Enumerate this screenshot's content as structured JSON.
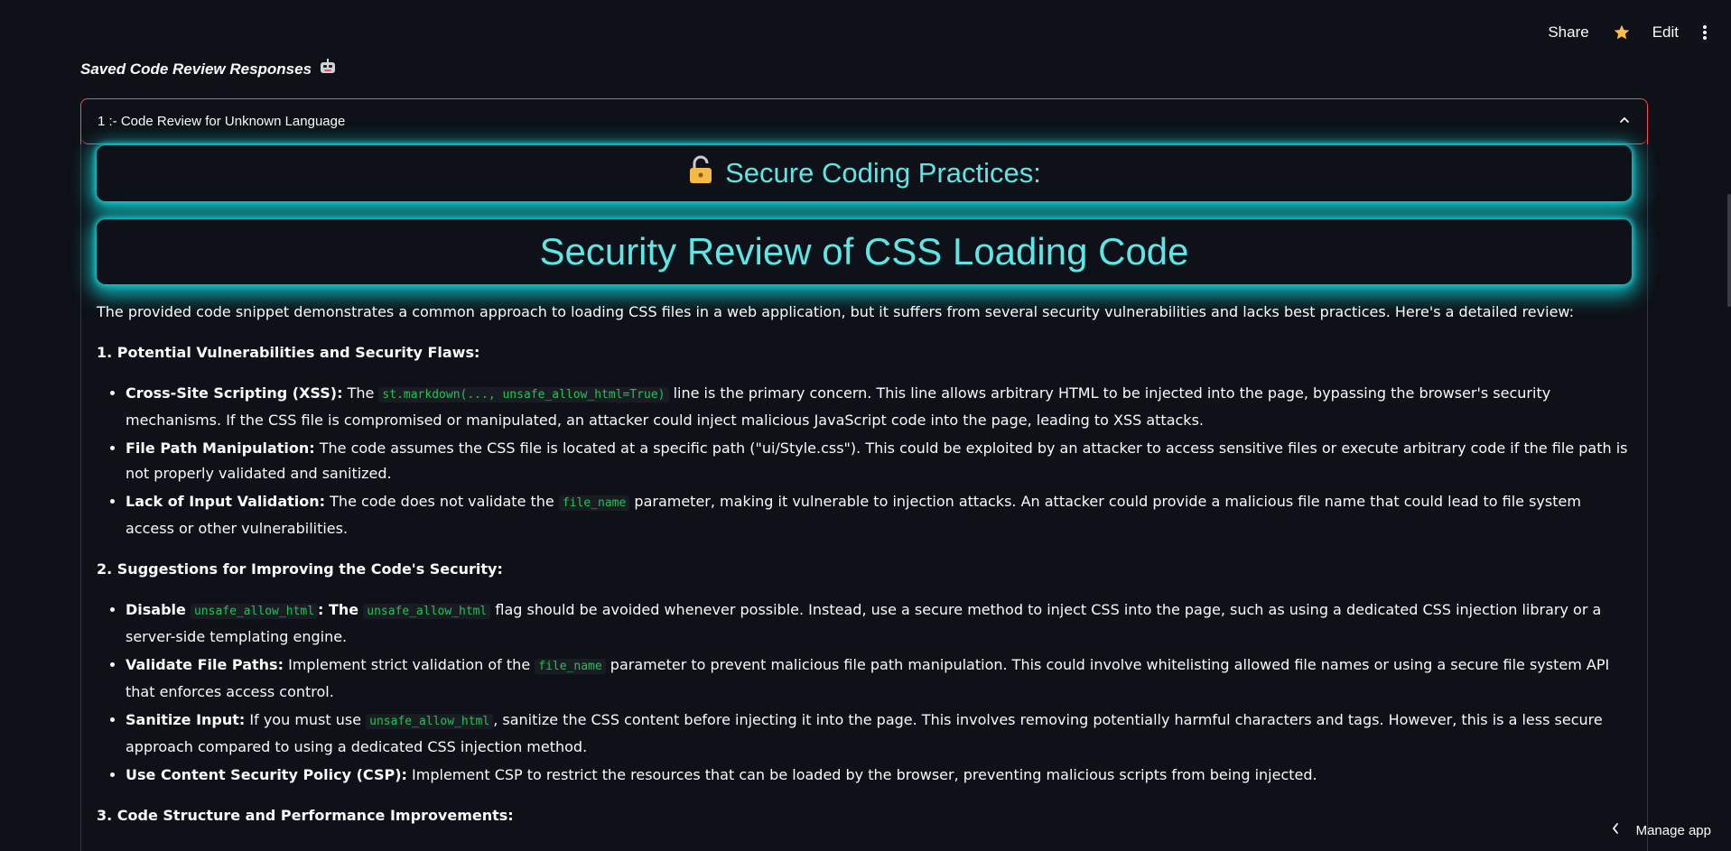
{
  "toolbar": {
    "share_label": "Share",
    "edit_label": "Edit"
  },
  "page": {
    "subtitle": "Saved Code Review Responses"
  },
  "expander": {
    "title": "1 :- Code Review for Unknown Language"
  },
  "headers": {
    "practices": "Secure Coding Practices:",
    "review_title": "Security Review of CSS Loading Code"
  },
  "content": {
    "intro": "The provided code snippet demonstrates a common approach to loading CSS files in a web application, but it suffers from several security vulnerabilities and lacks best practices. Here's a detailed review:",
    "section1": "1. Potential Vulnerabilities and Security Flaws:",
    "s1_items": [
      {
        "title": "Cross-Site Scripting (XSS):",
        "pre": "The",
        "code": "st.markdown(..., unsafe_allow_html=True)",
        "text": "line is the primary concern. This line allows arbitrary HTML to be injected into the page, bypassing the browser's security mechanisms. If the CSS file is compromised or manipulated, an attacker could inject malicious JavaScript code into the page, leading to XSS attacks."
      },
      {
        "title": "File Path Manipulation:",
        "text": "The code assumes the CSS file is located at a specific path (\"ui/Style.css\"). This could be exploited by an attacker to access sensitive files or execute arbitrary code if the file path is not properly validated and sanitized."
      },
      {
        "title": "Lack of Input Validation:",
        "pre": "The code does not validate the",
        "code": "file_name",
        "text": "parameter, making it vulnerable to injection attacks. An attacker could provide a malicious file name that could lead to file system access or other vulnerabilities."
      }
    ],
    "section2": "2. Suggestions for Improving the Code's Security:",
    "s2_items": [
      {
        "title": "Disable",
        "title_code": "unsafe_allow_html",
        "pre": ": The",
        "code": "unsafe_allow_html",
        "text": "flag should be avoided whenever possible. Instead, use a secure method to inject CSS into the page, such as using a dedicated CSS injection library or a server-side templating engine."
      },
      {
        "title": "Validate File Paths:",
        "pre": "Implement strict validation of the",
        "code": "file_name",
        "text": "parameter to prevent malicious file path manipulation. This could involve whitelisting allowed file names or using a secure file system API that enforces access control."
      },
      {
        "title": "Sanitize Input:",
        "pre": "If you must use",
        "code": "unsafe_allow_html",
        "text": ", sanitize the CSS content before injecting it into the page. This involves removing potentially harmful characters and tags. However, this is a less secure approach compared to using a dedicated CSS injection method."
      },
      {
        "title": "Use Content Security Policy (CSP):",
        "text": "Implement CSP to restrict the resources that can be loaded by the browser, preventing malicious scripts from being injected."
      }
    ],
    "section3": "3. Code Structure and Performance Improvements:"
  },
  "footer": {
    "manage_label": "Manage app"
  },
  "icons": {
    "star_color": "#ffbd45",
    "lock_color": "#f5b945",
    "accent": "#5ee6e6",
    "border_accent": "#ff4b4b"
  }
}
